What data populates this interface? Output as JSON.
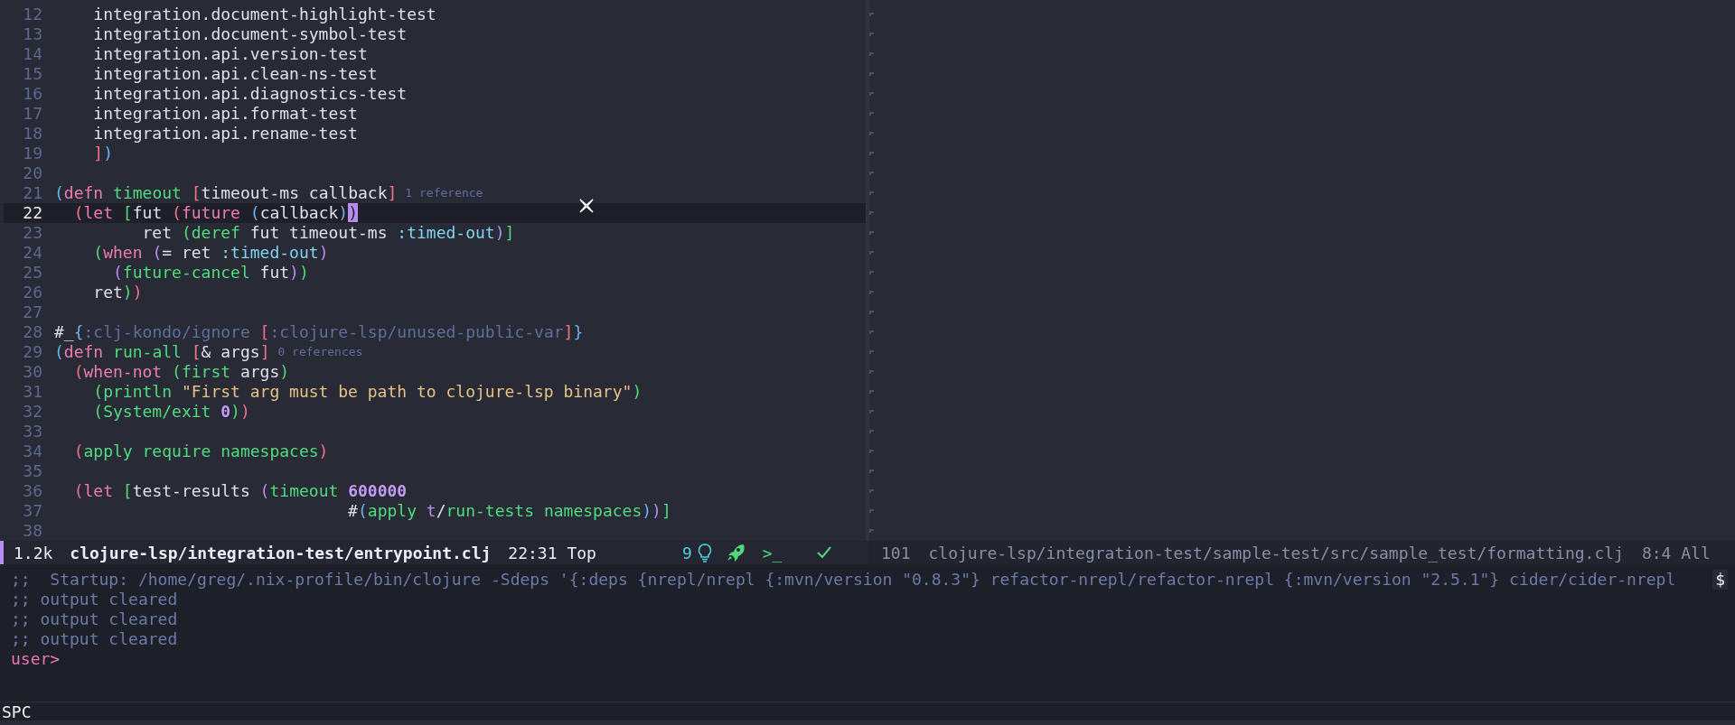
{
  "editor": {
    "lines": [
      {
        "number": "12",
        "current": false,
        "code": [
          {
            "kind": "plain",
            "text": "    integration.document-highlight-test"
          }
        ]
      },
      {
        "number": "13",
        "current": false,
        "code": [
          {
            "kind": "plain",
            "text": "    integration.document-symbol-test"
          }
        ]
      },
      {
        "number": "14",
        "current": false,
        "code": [
          {
            "kind": "plain",
            "text": "    integration.api.version-test"
          }
        ]
      },
      {
        "number": "15",
        "current": false,
        "code": [
          {
            "kind": "plain",
            "text": "    integration.api.clean-ns-test"
          }
        ]
      },
      {
        "number": "16",
        "current": false,
        "code": [
          {
            "kind": "plain",
            "text": "    integration.api.diagnostics-test"
          }
        ]
      },
      {
        "number": "17",
        "current": false,
        "code": [
          {
            "kind": "plain",
            "text": "    integration.api.format-test"
          }
        ]
      },
      {
        "number": "18",
        "current": false,
        "code": [
          {
            "kind": "plain",
            "text": "    integration.api.rename-test"
          }
        ]
      },
      {
        "number": "19",
        "current": false,
        "code": [
          {
            "kind": "d2",
            "text": "    ]"
          },
          {
            "kind": "d1",
            "text": ")"
          }
        ]
      },
      {
        "number": "20",
        "current": false
      },
      {
        "number": "21",
        "current": false,
        "code": [
          {
            "kind": "d1",
            "text": "("
          },
          {
            "kind": "keyword",
            "text": "defn"
          },
          {
            "kind": "func",
            "text": " timeout"
          },
          {
            "kind": "d2",
            "text": " ["
          },
          {
            "kind": "plain",
            "text": "timeout-ms callback"
          },
          {
            "kind": "d2",
            "text": "]"
          }
        ],
        "lens": "1 reference"
      },
      {
        "number": "22",
        "current": true,
        "code": [
          {
            "kind": "d2",
            "text": "  ("
          },
          {
            "kind": "keyword",
            "text": "let"
          },
          {
            "kind": "d4",
            "text": " ["
          },
          {
            "kind": "plain",
            "text": "fut "
          },
          {
            "kind": "d2",
            "text": "("
          },
          {
            "kind": "keyword",
            "text": "future"
          },
          {
            "kind": "d1",
            "text": " ("
          },
          {
            "kind": "plain",
            "text": "callback"
          },
          {
            "kind": "d1",
            "text": ")"
          },
          {
            "kind": "match",
            "text": ")"
          }
        ]
      },
      {
        "number": "23",
        "current": false,
        "code": [
          {
            "kind": "plain",
            "text": "         ret "
          },
          {
            "kind": "d4",
            "text": "("
          },
          {
            "kind": "func",
            "text": "deref"
          },
          {
            "kind": "plain",
            "text": " fut timeout-ms "
          },
          {
            "kind": "kw",
            "text": ":timed-out"
          },
          {
            "kind": "d3",
            "text": ")"
          },
          {
            "kind": "d4",
            "text": "]"
          }
        ]
      },
      {
        "number": "24",
        "current": false,
        "code": [
          {
            "kind": "d4",
            "text": "    ("
          },
          {
            "kind": "keyword",
            "text": "when"
          },
          {
            "kind": "d3",
            "text": " ("
          },
          {
            "kind": "plain",
            "text": "= ret "
          },
          {
            "kind": "kw",
            "text": ":timed-out"
          },
          {
            "kind": "d3",
            "text": ")"
          }
        ]
      },
      {
        "number": "25",
        "current": false,
        "code": [
          {
            "kind": "d3",
            "text": "      ("
          },
          {
            "kind": "func",
            "text": "future-cancel"
          },
          {
            "kind": "plain",
            "text": " fut"
          },
          {
            "kind": "d3",
            "text": ")"
          },
          {
            "kind": "d4",
            "text": ")"
          }
        ]
      },
      {
        "number": "26",
        "current": false,
        "code": [
          {
            "kind": "plain",
            "text": "    ret"
          },
          {
            "kind": "d4",
            "text": ")"
          },
          {
            "kind": "d2",
            "text": ")"
          }
        ]
      },
      {
        "number": "27",
        "current": false
      },
      {
        "number": "28",
        "current": false,
        "code": [
          {
            "kind": "plain",
            "text": "#_"
          },
          {
            "kind": "d1",
            "text": "{"
          },
          {
            "kind": "comment",
            "text": ":clj-kondo/ignore "
          },
          {
            "kind": "d2",
            "text": "["
          },
          {
            "kind": "comment",
            "text": ":clojure-lsp/unused-public-var"
          },
          {
            "kind": "d2",
            "text": "]"
          },
          {
            "kind": "d1",
            "text": "}"
          }
        ]
      },
      {
        "number": "29",
        "current": false,
        "code": [
          {
            "kind": "d1",
            "text": "("
          },
          {
            "kind": "keyword",
            "text": "defn"
          },
          {
            "kind": "func",
            "text": " run-all"
          },
          {
            "kind": "d2",
            "text": " ["
          },
          {
            "kind": "plain",
            "text": "& args"
          },
          {
            "kind": "d2",
            "text": "]"
          }
        ],
        "lens": "0 references"
      },
      {
        "number": "30",
        "current": false,
        "code": [
          {
            "kind": "d2",
            "text": "  ("
          },
          {
            "kind": "keyword",
            "text": "when-not"
          },
          {
            "kind": "d4",
            "text": " ("
          },
          {
            "kind": "func",
            "text": "first"
          },
          {
            "kind": "plain",
            "text": " args"
          },
          {
            "kind": "d4",
            "text": ")"
          }
        ]
      },
      {
        "number": "31",
        "current": false,
        "code": [
          {
            "kind": "d4",
            "text": "    ("
          },
          {
            "kind": "func",
            "text": "println"
          },
          {
            "kind": "string",
            "text": " \"First arg must be path to clojure-lsp binary\""
          },
          {
            "kind": "d4",
            "text": ")"
          }
        ]
      },
      {
        "number": "32",
        "current": false,
        "code": [
          {
            "kind": "d4",
            "text": "    ("
          },
          {
            "kind": "func",
            "text": "System/exit"
          },
          {
            "kind": "number",
            "text": " 0"
          },
          {
            "kind": "d4",
            "text": ")"
          },
          {
            "kind": "d2",
            "text": ")"
          }
        ]
      },
      {
        "number": "33",
        "current": false
      },
      {
        "number": "34",
        "current": false,
        "code": [
          {
            "kind": "d2",
            "text": "  ("
          },
          {
            "kind": "func",
            "text": "apply require namespaces"
          },
          {
            "kind": "d2",
            "text": ")"
          }
        ]
      },
      {
        "number": "35",
        "current": false
      },
      {
        "number": "36",
        "current": false,
        "code": [
          {
            "kind": "d2",
            "text": "  ("
          },
          {
            "kind": "keyword",
            "text": "let"
          },
          {
            "kind": "d4",
            "text": " ["
          },
          {
            "kind": "plain",
            "text": "test-results "
          },
          {
            "kind": "d3",
            "text": "("
          },
          {
            "kind": "func",
            "text": "timeout"
          },
          {
            "kind": "number",
            "text": " 600000"
          }
        ]
      },
      {
        "number": "37",
        "current": false,
        "code": [
          {
            "kind": "plain",
            "text": "                              #"
          },
          {
            "kind": "d1",
            "text": "("
          },
          {
            "kind": "func",
            "text": "apply"
          },
          {
            "kind": "d3",
            "text": " t"
          },
          {
            "kind": "plain",
            "text": "/"
          },
          {
            "kind": "func",
            "text": "run-tests namespaces"
          },
          {
            "kind": "d1",
            "text": ")"
          },
          {
            "kind": "d3",
            "text": ")"
          },
          {
            "kind": "d4",
            "text": "]"
          }
        ]
      },
      {
        "number": "38",
        "current": false
      }
    ]
  },
  "mode_lines": [
    {
      "active": true,
      "size": "1.2k",
      "file": "clojure-lsp/integration-test/entrypoint.clj",
      "position": "22:31 Top",
      "lsp_count": "9",
      "terminal": ">_"
    },
    {
      "active": false,
      "size": "101",
      "file": "clojure-lsp/integration-test/sample-test/src/sample_test/formatting.clj",
      "position": "8:4 All"
    }
  ],
  "repl": {
    "lines": [
      {
        "kind": "comment",
        "text": ";;  Startup: /home/greg/.nix-profile/bin/clojure -Sdeps '{:deps {nrepl/nrepl {:mvn/version \"0.8.3\"} refactor-nrepl/refactor-nrepl {:mvn/version \"2.5.1\"} cider/cider-nrepl",
        "truncation": "$"
      },
      {
        "kind": "comment",
        "text": ";; output cleared"
      },
      {
        "kind": "comment",
        "text": ";; output cleared"
      },
      {
        "kind": "comment",
        "text": ";; output cleared"
      },
      {
        "kind": "prompt",
        "text": "user>"
      }
    ]
  },
  "echo_area": {
    "text": "SPC"
  }
}
